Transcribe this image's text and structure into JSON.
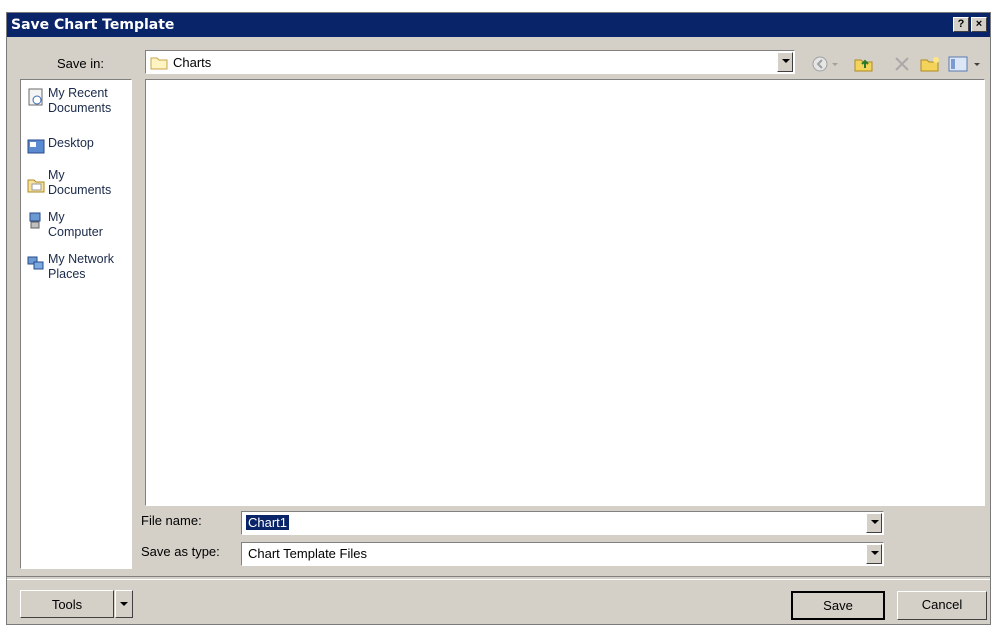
{
  "window": {
    "title": "Save Chart Template",
    "help_label": "?",
    "close_label": "×"
  },
  "toolbar": {
    "save_in_label": "Save in:",
    "save_in_value": "Charts",
    "icons": [
      "back-icon",
      "up-folder-icon",
      "delete-icon",
      "new-folder-icon",
      "views-icon"
    ]
  },
  "places": [
    {
      "label_line1": "My Recent",
      "label_line2": "Documents",
      "icon": "recent-documents-icon"
    },
    {
      "label_line1": "Desktop",
      "label_line2": "",
      "icon": "desktop-icon"
    },
    {
      "label_line1": "My",
      "label_line2": "Documents",
      "icon": "my-documents-icon"
    },
    {
      "label_line1": "My",
      "label_line2": "Computer",
      "icon": "my-computer-icon"
    },
    {
      "label_line1": "My Network",
      "label_line2": "Places",
      "icon": "network-places-icon"
    }
  ],
  "form": {
    "file_name_label": "File name:",
    "file_name_value": "Chart1",
    "save_as_type_label": "Save as type:",
    "save_as_type_value": "Chart Template Files"
  },
  "buttons": {
    "tools_label": "Tools",
    "save_label": "Save",
    "cancel_label": "Cancel"
  },
  "colors": {
    "titlebar": "#0a246a",
    "dialog_bg": "#d4d0c8",
    "selection": "#0a246a"
  }
}
